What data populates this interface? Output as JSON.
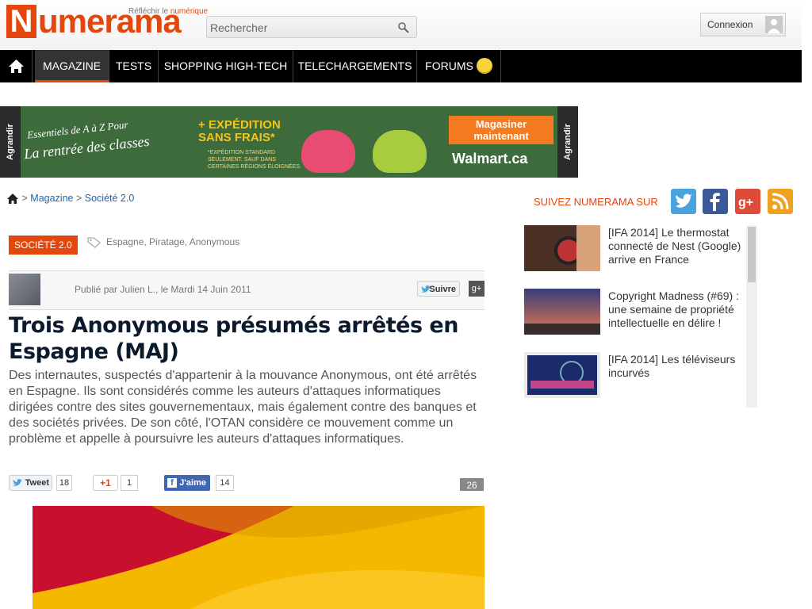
{
  "header": {
    "logo_initial": "N",
    "logo_rest": "umerama",
    "tagline_prefix": "Réfléchir le",
    "tagline_accent": "numérique",
    "search_placeholder": "Rechercher",
    "login_label": "Connexion"
  },
  "nav": {
    "items": [
      {
        "label": "MAGAZINE",
        "active": true
      },
      {
        "label": "TESTS"
      },
      {
        "label": "SHOPPING HIGH-TECH"
      },
      {
        "label": "TELECHARGEMENTS"
      },
      {
        "label": "FORUMS"
      }
    ]
  },
  "ad": {
    "side_label": "Agrandir",
    "line1": "Essentiels de A à Z Pour",
    "line2": "La rentrée des classes",
    "shipping": "+ EXPÉDITION\nSANS FRAIS*",
    "fineprint": "*EXPÉDITION STANDARD\nSEULEMENT. SAUF DANS\nCERTAINES RÉGIONS ÉLOIGNÉES.",
    "cta": "Magasiner\nmaintenant",
    "brand": "Walmart.ca"
  },
  "breadcrumb": {
    "sep": ">",
    "item1": "Magazine",
    "item2": "Société 2.0"
  },
  "article": {
    "category": "SOCIÉTÉ 2.0",
    "tags": "Espagne, Piratage, Anonymous",
    "byline": "Publié par Julien L., le Mardi 14 Juin 2011",
    "follow_label": "Suivre",
    "gplus_label": "g+",
    "title": "Trois Anonymous présumés arrêtés en Espagne (MAJ)",
    "lede": "Des internautes, suspectés d'appartenir à la mouvance Anonymous, ont été arrêtés en Espagne. Ils sont considérés comme les auteurs d'attaques informatiques dirigées contre des sites gouvernementaux, mais également contre des banques et des sociétés privées. De son côté, l'OTAN considère ce mouvement comme un problème et appelle à poursuivre les auteurs d'attaques informatiques."
  },
  "share": {
    "tweet_label": "Tweet",
    "tweet_count": "18",
    "gplus_label": "+1",
    "gplus_count": "1",
    "like_label": "J'aime",
    "like_count": "14",
    "comments": "26"
  },
  "sidebar": {
    "follow_label": "SUIVEZ NUMERAMA SUR",
    "social": [
      {
        "name": "twitter",
        "color": "#4aa3df"
      },
      {
        "name": "facebook",
        "color": "#3b5998"
      },
      {
        "name": "googleplus",
        "color": "#dd4b39"
      },
      {
        "name": "rss",
        "color": "#f0a11f"
      }
    ],
    "items": [
      {
        "title": "[IFA 2014] Le thermostat connecté de Nest (Google) arrive en France"
      },
      {
        "title": "Copyright Madness (#69) : une semaine de propriété intellectuelle en délire !"
      },
      {
        "title": "[IFA 2014] Les téléviseurs incurvés"
      }
    ]
  },
  "colors": {
    "brand": "#e4470e",
    "nav_bg": "#000000",
    "link": "#1f66a8"
  }
}
